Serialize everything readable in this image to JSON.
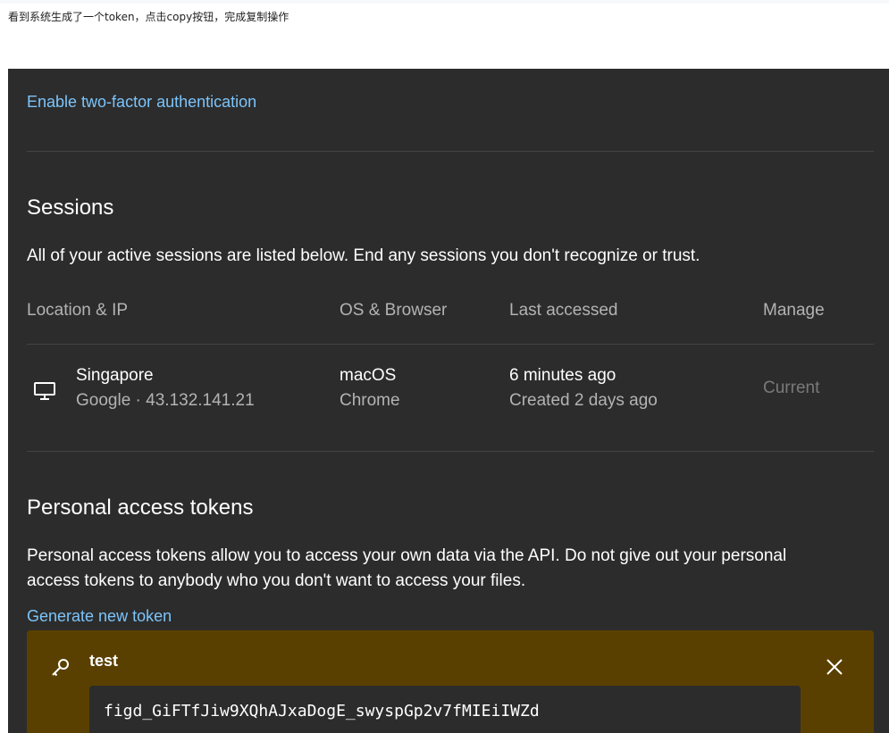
{
  "caption": "看到系统生成了一个token，点击copy按钮，完成复制操作",
  "two_factor": {
    "link_label": "Enable two-factor authentication"
  },
  "sessions": {
    "title": "Sessions",
    "description": "All of your active sessions are listed below. End any sessions you don't recognize or trust.",
    "columns": [
      "Location & IP",
      "OS & Browser",
      "Last accessed",
      "Manage"
    ],
    "rows": [
      {
        "device_icon": "monitor-icon",
        "location": "Singapore",
        "ip_line": "Google · 43.132.141.21",
        "os": "macOS",
        "browser": "Chrome",
        "last_accessed": "6 minutes ago",
        "created": "Created 2 days ago",
        "manage": "Current"
      }
    ]
  },
  "tokens": {
    "title": "Personal access tokens",
    "description_line1": "Personal access tokens allow you to access your own data via the API. Do not give out your personal",
    "description_line2": "access tokens to anybody who you don't want to access your files.",
    "generate_label": "Generate new token",
    "card": {
      "icon": "key-icon",
      "name": "test",
      "value": "figd_GiFTfJiw9XQhAJxaDogE_swyspGp2v7fMIEiIWZd",
      "close_icon": "close-icon"
    }
  },
  "colors": {
    "panel_bg": "#2c2c2c",
    "link": "#7cc4fa",
    "token_card_bg": "#5a4000",
    "divider": "#444444"
  }
}
